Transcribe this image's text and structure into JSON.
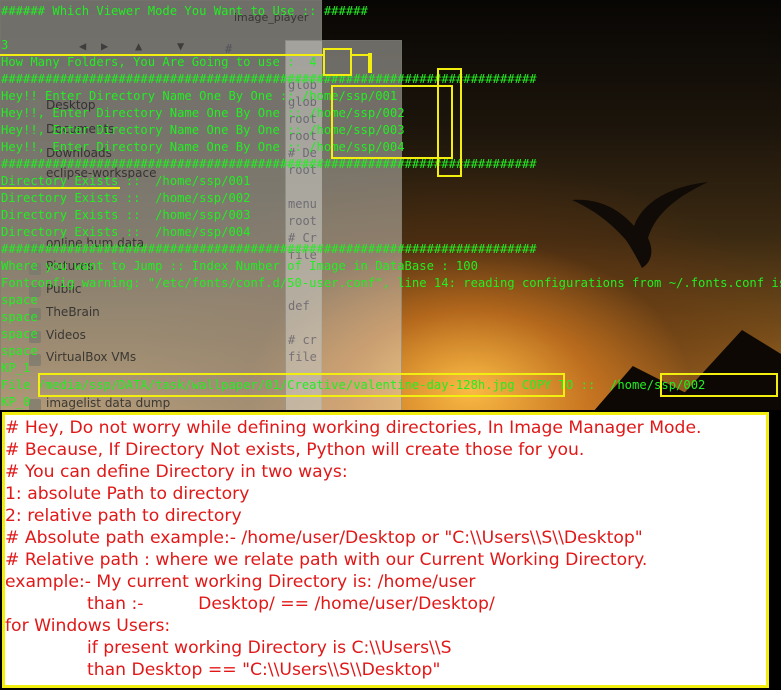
{
  "colors": {
    "terminal_text": "#22ee22",
    "highlight": "#f2ee10",
    "note_text": "#e01818"
  },
  "background": {
    "file_manager": {
      "tab": "image_player",
      "items": [
        "Desktop",
        "Documents",
        "Downloads",
        "eclipse-workspace",
        "online hum data",
        "Pictures",
        "Public",
        "TheBrain",
        "Videos",
        "VirtualBox VMs",
        "imagelist data dump"
      ],
      "icons": [
        "folder-icon"
      ]
    },
    "editor_fragments": [
      "#",
      "glob",
      "glob",
      "root",
      "root",
      "# De",
      "root",
      "menu",
      "root",
      "# Cr",
      "file",
      "def",
      "# cr",
      "file"
    ]
  },
  "terminal": {
    "lines": [
      "###### Which Viewer Mode You Want to Use :: ######",
      "",
      "3",
      "How Many Folders, You Are Going to use :  4",
      "#########################################################################",
      "Hey!! Enter Directory Name One By One :: /home/ssp/001",
      "Hey!!, Enter Directory Name One By One :: /home/ssp/002",
      "Hey!!, Enter Directory Name One By One :: /home/ssp/003",
      "Hey!!, Enter Directory Name One By One :: /home/ssp/004",
      "#########################################################################",
      "Directory Exists ::  /home/ssp/001",
      "Directory Exists ::  /home/ssp/002",
      "Directory Exists ::  /home/ssp/003",
      "Directory Exists ::  /home/ssp/004",
      "#########################################################################",
      "Where you want to Jump :: Index Number of Image in DataBase : 100",
      "Fontconfig warning: \"/etc/fonts/conf.d/50-user.conf\", line 14: reading configurations from ~/.fonts.conf is deprecated.",
      "space",
      "space",
      "space",
      "space",
      "KP_1",
      "File /media/ssp/DATA/task/wallpaper/01/Creative/valentine-day-128h.jpg COPY TO ::  /home/ssp/002",
      "KP_0"
    ]
  },
  "notes": {
    "lines": [
      "# Hey, Do not worry while defining working directories, In Image Manager Mode.",
      "# Because, If Directory Not exists, Python will create those for you.",
      "# You can define Directory in two ways:",
      "1: absolute Path to directory",
      "2: relative path to directory",
      "# Absolute path example:- /home/user/Desktop or \"C:\\\\Users\\\\S\\\\Desktop\"",
      "# Relative path : where we relate path with our Current Working Directory.",
      "example:- My current working Directory is: /home/user",
      "               than :-          Desktop/ == /home/user/Desktop/",
      "for Windows Users:",
      "               if present working Directory is C:\\\\Users\\\\S",
      "               than Desktop == \"C:\\\\Users\\\\S\\\\Desktop\""
    ]
  }
}
